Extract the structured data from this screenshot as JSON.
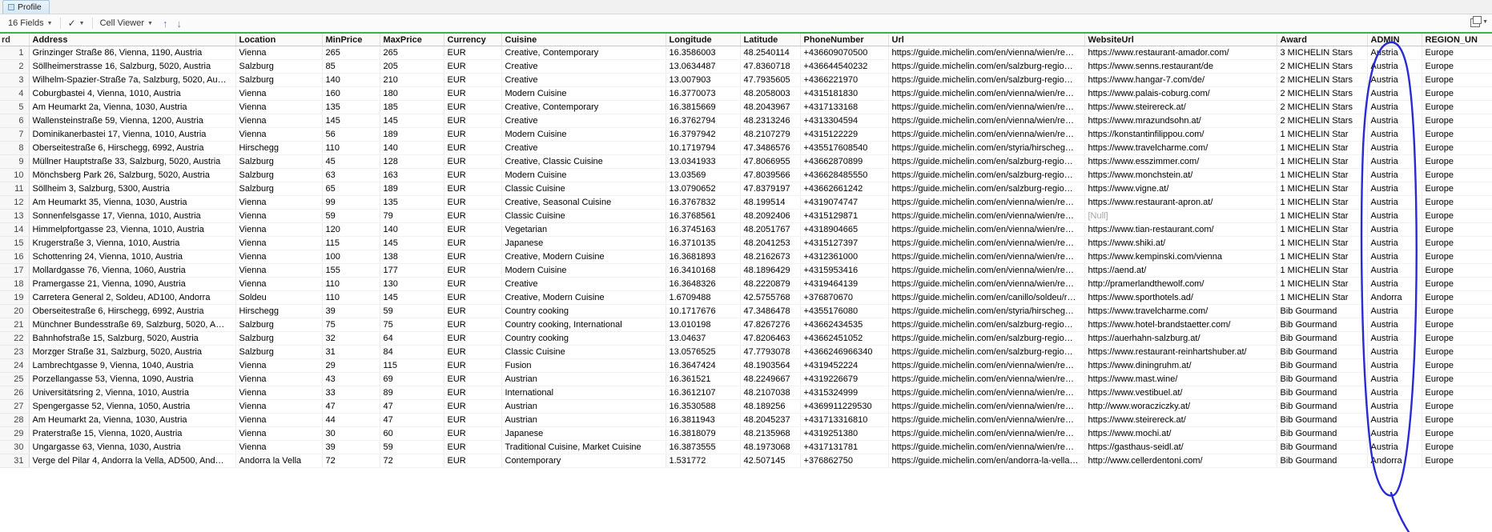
{
  "tabbar": {
    "tabs": [
      {
        "label": "Profile"
      }
    ]
  },
  "toolbar": {
    "fields_button_label": "16 Fields",
    "check_icon": "check-icon",
    "cell_viewer_button_label": "Cell Viewer",
    "up_arrow": "↑",
    "down_arrow": "↓",
    "chevron": "▼"
  },
  "table": {
    "corner_header": "rd",
    "null_text": "[Null]",
    "columns": [
      "Address",
      "Location",
      "MinPrice",
      "MaxPrice",
      "Currency",
      "Cuisine",
      "Longitude",
      "Latitude",
      "PhoneNumber",
      "Url",
      "WebsiteUrl",
      "Award",
      "ADMIN",
      "REGION_UN"
    ],
    "rows": [
      [
        "1",
        "Grinzinger Straße 86, Vienna, 1190, Austria",
        "Vienna",
        "265",
        "265",
        "EUR",
        "Creative, Contemporary",
        "16.3586003",
        "48.2540114",
        "+436609070500",
        "https://guide.michelin.com/en/vienna/wien/re…",
        "https://www.restaurant-amador.com/",
        "3 MICHELIN Stars",
        "Austria",
        "Europe"
      ],
      [
        "2",
        "Söllheimerstrasse 16, Salzburg, 5020, Austria",
        "Salzburg",
        "85",
        "205",
        "EUR",
        "Creative",
        "13.0634487",
        "47.8360718",
        "+436644540232",
        "https://guide.michelin.com/en/salzburg-regio…",
        "https://www.senns.restaurant/de",
        "2 MICHELIN Stars",
        "Austria",
        "Europe"
      ],
      [
        "3",
        "Wilhelm-Spazier-Straße 7a, Salzburg, 5020, Au…",
        "Salzburg",
        "140",
        "210",
        "EUR",
        "Creative",
        "13.007903",
        "47.7935605",
        "+4366221970",
        "https://guide.michelin.com/en/salzburg-regio…",
        "https://www.hangar-7.com/de/",
        "2 MICHELIN Stars",
        "Austria",
        "Europe"
      ],
      [
        "4",
        "Coburgbastei 4, Vienna, 1010, Austria",
        "Vienna",
        "160",
        "180",
        "EUR",
        "Modern Cuisine",
        "16.3770073",
        "48.2058003",
        "+4315181830",
        "https://guide.michelin.com/en/vienna/wien/re…",
        "https://www.palais-coburg.com/",
        "2 MICHELIN Stars",
        "Austria",
        "Europe"
      ],
      [
        "5",
        "Am Heumarkt 2a, Vienna, 1030, Austria",
        "Vienna",
        "135",
        "185",
        "EUR",
        "Creative, Contemporary",
        "16.3815669",
        "48.2043967",
        "+4317133168",
        "https://guide.michelin.com/en/vienna/wien/re…",
        "https://www.steirereck.at/",
        "2 MICHELIN Stars",
        "Austria",
        "Europe"
      ],
      [
        "6",
        "Wallensteinstraße 59, Vienna, 1200, Austria",
        "Vienna",
        "145",
        "145",
        "EUR",
        "Creative",
        "16.3762794",
        "48.2313246",
        "+4313304594",
        "https://guide.michelin.com/en/vienna/wien/re…",
        "https://www.mrazundsohn.at/",
        "2 MICHELIN Stars",
        "Austria",
        "Europe"
      ],
      [
        "7",
        "Dominikanerbastei 17, Vienna, 1010, Austria",
        "Vienna",
        "56",
        "189",
        "EUR",
        "Modern Cuisine",
        "16.3797942",
        "48.2107279",
        "+4315122229",
        "https://guide.michelin.com/en/vienna/wien/re…",
        "https://konstantinfilippou.com/",
        "1 MICHELIN Star",
        "Austria",
        "Europe"
      ],
      [
        "8",
        "Oberseitestraße 6, Hirschegg, 6992, Austria",
        "Hirschegg",
        "110",
        "140",
        "EUR",
        "Creative",
        "10.1719794",
        "47.3486576",
        "+435517608540",
        "https://guide.michelin.com/en/styria/hirscheg…",
        "https://www.travelcharme.com/",
        "1 MICHELIN Star",
        "Austria",
        "Europe"
      ],
      [
        "9",
        "Müllner Hauptstraße 33, Salzburg, 5020, Austria",
        "Salzburg",
        "45",
        "128",
        "EUR",
        "Creative, Classic Cuisine",
        "13.0341933",
        "47.8066955",
        "+43662870899",
        "https://guide.michelin.com/en/salzburg-regio…",
        "https://www.esszimmer.com/",
        "1 MICHELIN Star",
        "Austria",
        "Europe"
      ],
      [
        "10",
        "Mönchsberg Park 26, Salzburg, 5020, Austria",
        "Salzburg",
        "63",
        "163",
        "EUR",
        "Modern Cuisine",
        "13.03569",
        "47.8039566",
        "+436628485550",
        "https://guide.michelin.com/en/salzburg-regio…",
        "https://www.monchstein.at/",
        "1 MICHELIN Star",
        "Austria",
        "Europe"
      ],
      [
        "11",
        "Söllheim 3, Salzburg, 5300, Austria",
        "Salzburg",
        "65",
        "189",
        "EUR",
        "Classic Cuisine",
        "13.0790652",
        "47.8379197",
        "+43662661242",
        "https://guide.michelin.com/en/salzburg-regio…",
        "https://www.vigne.at/",
        "1 MICHELIN Star",
        "Austria",
        "Europe"
      ],
      [
        "12",
        "Am Heumarkt 35, Vienna, 1030, Austria",
        "Vienna",
        "99",
        "135",
        "EUR",
        "Creative, Seasonal Cuisine",
        "16.3767832",
        "48.199514",
        "+4319074747",
        "https://guide.michelin.com/en/vienna/wien/re…",
        "https://www.restaurant-apron.at/",
        "1 MICHELIN Star",
        "Austria",
        "Europe"
      ],
      [
        "13",
        "Sonnenfelsgasse 17, Vienna, 1010, Austria",
        "Vienna",
        "59",
        "79",
        "EUR",
        "Classic Cuisine",
        "16.3768561",
        "48.2092406",
        "+4315129871",
        "https://guide.michelin.com/en/vienna/wien/re…",
        "[Null]",
        "1 MICHELIN Star",
        "Austria",
        "Europe"
      ],
      [
        "14",
        "Himmelpfortgasse 23, Vienna, 1010, Austria",
        "Vienna",
        "120",
        "140",
        "EUR",
        "Vegetarian",
        "16.3745163",
        "48.2051767",
        "+4318904665",
        "https://guide.michelin.com/en/vienna/wien/re…",
        "https://www.tian-restaurant.com/",
        "1 MICHELIN Star",
        "Austria",
        "Europe"
      ],
      [
        "15",
        "Krugerstraße 3, Vienna, 1010, Austria",
        "Vienna",
        "115",
        "145",
        "EUR",
        "Japanese",
        "16.3710135",
        "48.2041253",
        "+4315127397",
        "https://guide.michelin.com/en/vienna/wien/re…",
        "https://www.shiki.at/",
        "1 MICHELIN Star",
        "Austria",
        "Europe"
      ],
      [
        "16",
        "Schottenring 24, Vienna, 1010, Austria",
        "Vienna",
        "100",
        "138",
        "EUR",
        "Creative, Modern Cuisine",
        "16.3681893",
        "48.2162673",
        "+4312361000",
        "https://guide.michelin.com/en/vienna/wien/re…",
        "https://www.kempinski.com/vienna",
        "1 MICHELIN Star",
        "Austria",
        "Europe"
      ],
      [
        "17",
        "Mollardgasse 76, Vienna, 1060, Austria",
        "Vienna",
        "155",
        "177",
        "EUR",
        "Modern Cuisine",
        "16.3410168",
        "48.1896429",
        "+4315953416",
        "https://guide.michelin.com/en/vienna/wien/re…",
        "https://aend.at/",
        "1 MICHELIN Star",
        "Austria",
        "Europe"
      ],
      [
        "18",
        "Pramergasse 21, Vienna, 1090, Austria",
        "Vienna",
        "110",
        "130",
        "EUR",
        "Creative",
        "16.3648326",
        "48.2220879",
        "+4319464139",
        "https://guide.michelin.com/en/vienna/wien/re…",
        "http://pramerlandthewolf.com/",
        "1 MICHELIN Star",
        "Austria",
        "Europe"
      ],
      [
        "19",
        "Carretera General 2, Soldeu, AD100, Andorra",
        "Soldeu",
        "110",
        "145",
        "EUR",
        "Creative, Modern Cuisine",
        "1.6709488",
        "42.5755768",
        "+376870670",
        "https://guide.michelin.com/en/canillo/soldeu/r…",
        "https://www.sporthotels.ad/",
        "1 MICHELIN Star",
        "Andorra",
        "Europe"
      ],
      [
        "20",
        "Oberseitestraße 6, Hirschegg, 6992, Austria",
        "Hirschegg",
        "39",
        "59",
        "EUR",
        "Country cooking",
        "10.1717676",
        "47.3486478",
        "+4355176080",
        "https://guide.michelin.com/en/styria/hirscheg…",
        "https://www.travelcharme.com/",
        "Bib Gourmand",
        "Austria",
        "Europe"
      ],
      [
        "21",
        "Münchner Bundesstraße 69, Salzburg, 5020, A…",
        "Salzburg",
        "75",
        "75",
        "EUR",
        "Country cooking, International",
        "13.010198",
        "47.8267276",
        "+43662434535",
        "https://guide.michelin.com/en/salzburg-regio…",
        "https://www.hotel-brandstaetter.com/",
        "Bib Gourmand",
        "Austria",
        "Europe"
      ],
      [
        "22",
        "Bahnhofstraße 15, Salzburg, 5020, Austria",
        "Salzburg",
        "32",
        "64",
        "EUR",
        "Country cooking",
        "13.04637",
        "47.8206463",
        "+43662451052",
        "https://guide.michelin.com/en/salzburg-regio…",
        "https://auerhahn-salzburg.at/",
        "Bib Gourmand",
        "Austria",
        "Europe"
      ],
      [
        "23",
        "Morzger Straße 31, Salzburg, 5020, Austria",
        "Salzburg",
        "31",
        "84",
        "EUR",
        "Classic Cuisine",
        "13.0576525",
        "47.7793078",
        "+4366246966340",
        "https://guide.michelin.com/en/salzburg-regio…",
        "https://www.restaurant-reinhartshuber.at/",
        "Bib Gourmand",
        "Austria",
        "Europe"
      ],
      [
        "24",
        "Lambrechtgasse 9, Vienna, 1040, Austria",
        "Vienna",
        "29",
        "115",
        "EUR",
        "Fusion",
        "16.3647424",
        "48.1903564",
        "+4319452224",
        "https://guide.michelin.com/en/vienna/wien/re…",
        "https://www.diningruhm.at/",
        "Bib Gourmand",
        "Austria",
        "Europe"
      ],
      [
        "25",
        "Porzellangasse 53, Vienna, 1090, Austria",
        "Vienna",
        "43",
        "69",
        "EUR",
        "Austrian",
        "16.361521",
        "48.2249667",
        "+4319226679",
        "https://guide.michelin.com/en/vienna/wien/re…",
        "https://www.mast.wine/",
        "Bib Gourmand",
        "Austria",
        "Europe"
      ],
      [
        "26",
        "Universitätsring 2, Vienna, 1010, Austria",
        "Vienna",
        "33",
        "89",
        "EUR",
        "International",
        "16.3612107",
        "48.2107038",
        "+4315324999",
        "https://guide.michelin.com/en/vienna/wien/re…",
        "https://www.vestibuel.at/",
        "Bib Gourmand",
        "Austria",
        "Europe"
      ],
      [
        "27",
        "Spengergasse 52, Vienna, 1050, Austria",
        "Vienna",
        "47",
        "47",
        "EUR",
        "Austrian",
        "16.3530588",
        "48.189256",
        "+4369911229530",
        "https://guide.michelin.com/en/vienna/wien/re…",
        "http://www.woracziczky.at/",
        "Bib Gourmand",
        "Austria",
        "Europe"
      ],
      [
        "28",
        "Am Heumarkt 2a, Vienna, 1030, Austria",
        "Vienna",
        "44",
        "47",
        "EUR",
        "Austrian",
        "16.3811943",
        "48.2045237",
        "+431713316810",
        "https://guide.michelin.com/en/vienna/wien/re…",
        "https://www.steirereck.at/",
        "Bib Gourmand",
        "Austria",
        "Europe"
      ],
      [
        "29",
        "Praterstraße 15, Vienna, 1020, Austria",
        "Vienna",
        "30",
        "60",
        "EUR",
        "Japanese",
        "16.3818079",
        "48.2135968",
        "+4319251380",
        "https://guide.michelin.com/en/vienna/wien/re…",
        "https://www.mochi.at/",
        "Bib Gourmand",
        "Austria",
        "Europe"
      ],
      [
        "30",
        "Ungargasse 63, Vienna, 1030, Austria",
        "Vienna",
        "39",
        "59",
        "EUR",
        "Traditional Cuisine, Market Cuisine",
        "16.3873555",
        "48.1973068",
        "+4317131781",
        "https://guide.michelin.com/en/vienna/wien/re…",
        "https://gasthaus-seidl.at/",
        "Bib Gourmand",
        "Austria",
        "Europe"
      ],
      [
        "31",
        "Verge del Pilar 4, Andorra la Vella, AD500, And…",
        "Andorra la Vella",
        "72",
        "72",
        "EUR",
        "Contemporary",
        "1.531772",
        "42.507145",
        "+376862750",
        "https://guide.michelin.com/en/andorra-la-vella…",
        "http://www.cellerdentoni.com/",
        "Bib Gourmand",
        "Andorra",
        "Europe"
      ]
    ]
  },
  "annotation": {
    "shape": "hand-drawn-ellipse-around-admin-column",
    "color": "#2a2ad2"
  },
  "colors": {
    "tab_selected_bg": "#d6e8f6",
    "header_accent_green": "#35b44a",
    "grid_line": "#ededed"
  }
}
